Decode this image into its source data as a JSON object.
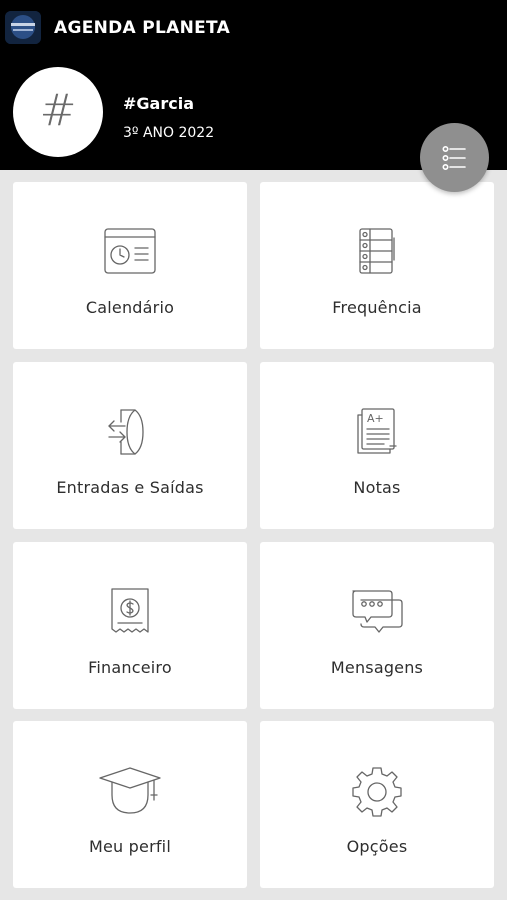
{
  "header": {
    "title": "AGENDA PLANETA",
    "avatar_symbol": "#",
    "user_name": "#Garcia",
    "class_info": "3º ANO 2022",
    "menu_icon": "list-menu-icon"
  },
  "tiles": [
    {
      "label": "Calendário",
      "icon": "calendar-clock-icon"
    },
    {
      "label": "Frequência",
      "icon": "attendance-list-icon"
    },
    {
      "label": "Entradas e Saídas",
      "icon": "door-arrows-icon"
    },
    {
      "label": "Notas",
      "icon": "grade-report-icon"
    },
    {
      "label": "Financeiro",
      "icon": "dollar-receipt-icon"
    },
    {
      "label": "Mensagens",
      "icon": "chat-bubbles-icon"
    },
    {
      "label": "Meu perfil",
      "icon": "graduate-profile-icon"
    },
    {
      "label": "Opções",
      "icon": "gear-icon"
    }
  ],
  "colors": {
    "header_bg": "#000000",
    "page_bg": "#e6e6e6",
    "tile_bg": "#ffffff",
    "fab_bg": "#8f8f8f",
    "icon_stroke": "#666666"
  }
}
